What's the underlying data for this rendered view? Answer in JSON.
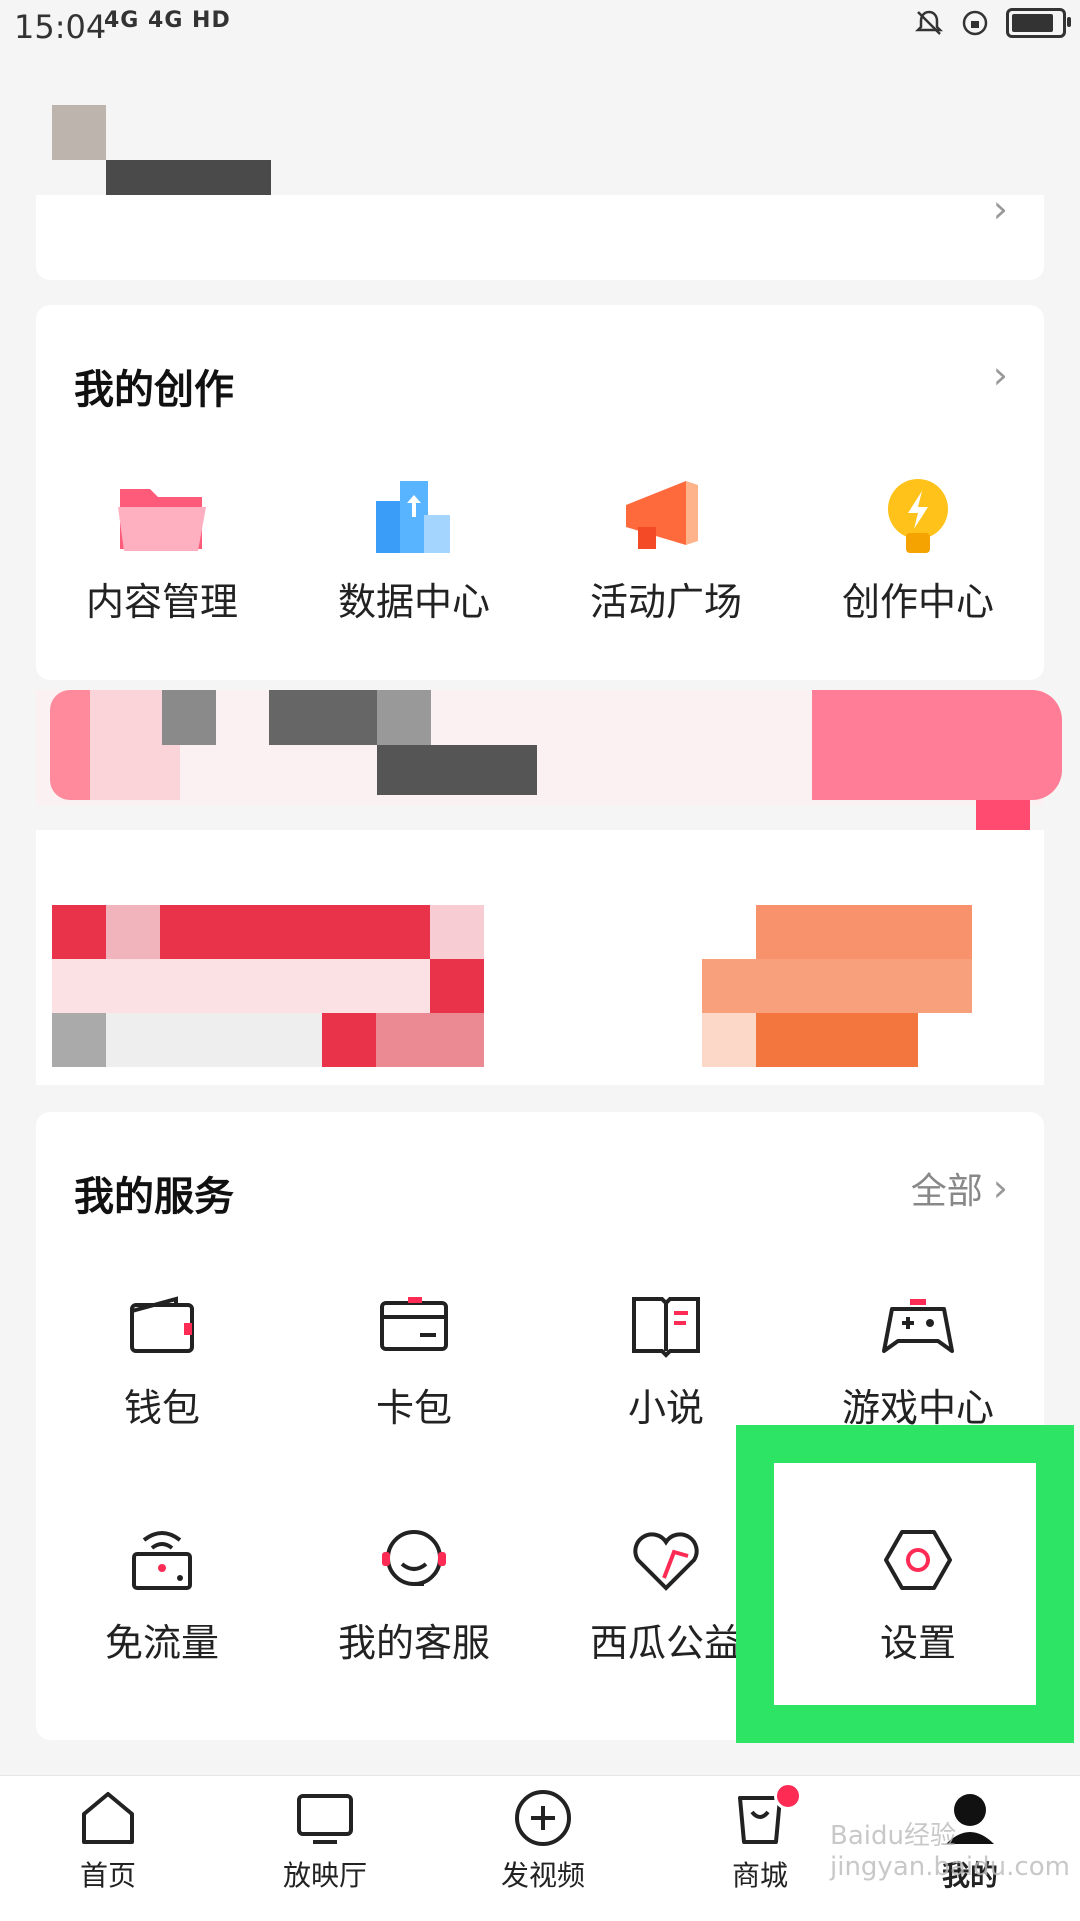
{
  "status": {
    "time": "15:04",
    "network": "4G 4G HD",
    "battery_level": 0.85
  },
  "creation": {
    "title": "我的创作",
    "items": [
      {
        "label": "内容管理",
        "icon": "folder-icon"
      },
      {
        "label": "数据中心",
        "icon": "data-chart-icon"
      },
      {
        "label": "活动广场",
        "icon": "megaphone-icon"
      },
      {
        "label": "创作中心",
        "icon": "lightbulb-icon"
      }
    ]
  },
  "services": {
    "title": "我的服务",
    "all_label": "全部",
    "row1": [
      {
        "label": "钱包",
        "icon": "wallet-icon"
      },
      {
        "label": "卡包",
        "icon": "card-icon"
      },
      {
        "label": "小说",
        "icon": "book-icon"
      },
      {
        "label": "游戏中心",
        "icon": "gamepad-icon"
      }
    ],
    "row2": [
      {
        "label": "免流量",
        "icon": "wifi-box-icon"
      },
      {
        "label": "我的客服",
        "icon": "headset-icon"
      },
      {
        "label": "西瓜公益",
        "icon": "heart-icon"
      },
      {
        "label": "设置",
        "icon": "settings-hex-icon"
      }
    ]
  },
  "nav": [
    {
      "label": "首页",
      "icon": "home-icon"
    },
    {
      "label": "放映厅",
      "icon": "tv-icon"
    },
    {
      "label": "发视频",
      "icon": "plus-circle-icon"
    },
    {
      "label": "商城",
      "icon": "bag-icon"
    },
    {
      "label": "我的",
      "icon": "profile-icon"
    }
  ],
  "watermark": "Baidu经验 jingyan.baidu.com",
  "colors": {
    "accent": "#fe2c55",
    "highlight": "#2ee465"
  }
}
